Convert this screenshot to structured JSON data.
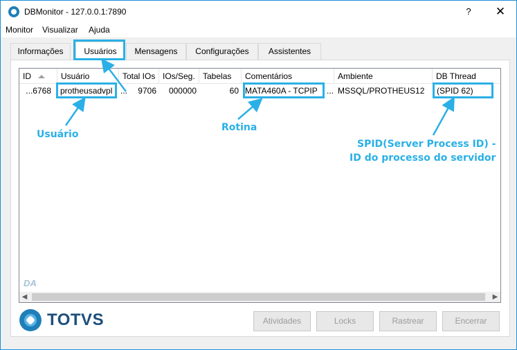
{
  "window": {
    "title": "DBMonitor - 127.0.0.1:7890",
    "help": "?",
    "close": "✕"
  },
  "menu": [
    "Monitor",
    "Visualizar",
    "Ajuda"
  ],
  "tabs": [
    {
      "label": "Informações"
    },
    {
      "label": "Usuários",
      "active": true
    },
    {
      "label": "Mensagens"
    },
    {
      "label": "Configurações"
    },
    {
      "label": "Assistentes"
    }
  ],
  "grid": {
    "columns": [
      "ID",
      "Usuário",
      "Total IOs",
      "IOs/Seg.",
      "Tabelas",
      "Comentários",
      "Ambiente",
      "DB Thread"
    ],
    "rows": [
      {
        "id": "...6768",
        "usuario": "protheusadvpl",
        "trunc": "...",
        "total_ios": "9706",
        "ios_seg": "000000",
        "tabelas": "60",
        "comentarios": "MATA460A - TCPIP",
        "trunc2": "...",
        "ambiente": "MSSQL/PROTHEUS12",
        "db_thread": "(SPID 62)"
      }
    ]
  },
  "watermark": "DA",
  "logo": {
    "text": "TOTVS",
    "colors": {
      "dark": "#1d4f7c",
      "light": "#5bb3e6"
    }
  },
  "buttons": [
    "Atividades",
    "Locks",
    "Rastrear",
    "Encerrar"
  ],
  "annotations": {
    "usuario": "Usuário",
    "rotina": "Rotina",
    "spid_line1": "SPID(Server Process ID) -",
    "spid_line2": "ID do processo do servidor",
    "color": "#2ab0e6"
  },
  "icons": {
    "app": "dbmonitor-icon",
    "sort": "sort-ascending-icon"
  }
}
